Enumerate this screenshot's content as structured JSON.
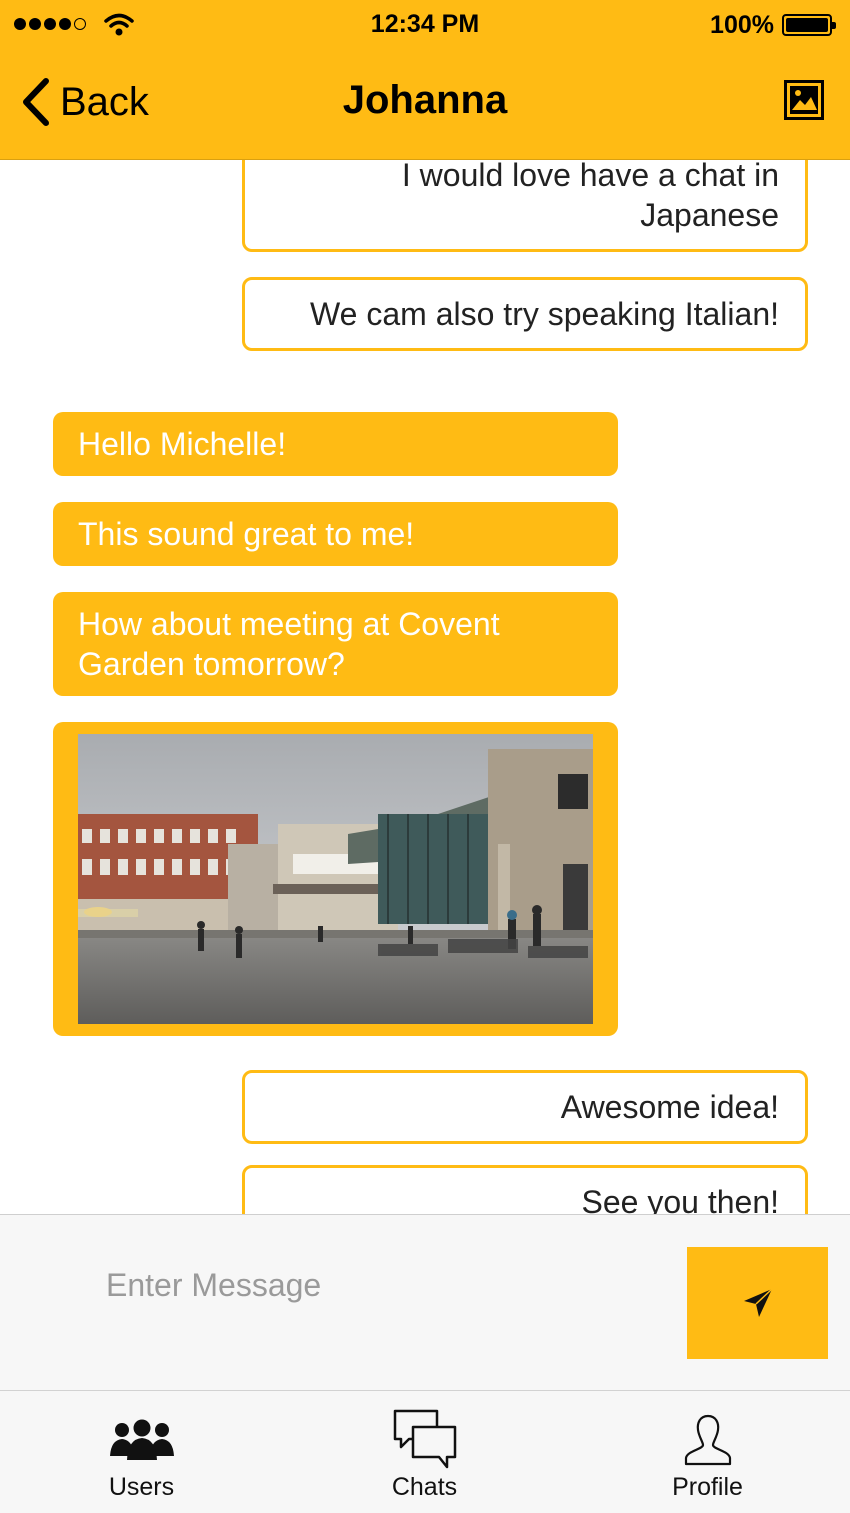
{
  "status_bar": {
    "time": "12:34 PM",
    "battery_percent": "100%",
    "signal_bars_filled": 4,
    "signal_bars_total": 5
  },
  "nav": {
    "back_label": "Back",
    "title": "Johanna",
    "icons": {
      "back": "chevron-left-icon",
      "action": "image-icon"
    }
  },
  "messages": [
    {
      "direction": "outgoing",
      "text": "I would love have a chat in Japanese"
    },
    {
      "direction": "outgoing",
      "text": "We cam also try speaking Italian!"
    },
    {
      "direction": "incoming",
      "text": "Hello Michelle!"
    },
    {
      "direction": "incoming",
      "text": "This sound great to me!"
    },
    {
      "direction": "incoming",
      "text": "How about meeting at Covent Garden tomorrow?"
    },
    {
      "direction": "incoming",
      "type": "image"
    },
    {
      "direction": "outgoing",
      "text": "Awesome idea!"
    },
    {
      "direction": "outgoing",
      "text": "See you then!"
    }
  ],
  "composer": {
    "placeholder": "Enter Message",
    "value": "",
    "send_icon": "send-icon"
  },
  "tabs": [
    {
      "label": "Users",
      "icon": "users-icon"
    },
    {
      "label": "Chats",
      "icon": "chats-icon"
    },
    {
      "label": "Profile",
      "icon": "profile-icon"
    }
  ],
  "colors": {
    "accent": "#ffbb14",
    "incoming_text": "#ffffff",
    "outgoing_bg": "#ffffff",
    "bar_bg": "#f7f7f7"
  }
}
